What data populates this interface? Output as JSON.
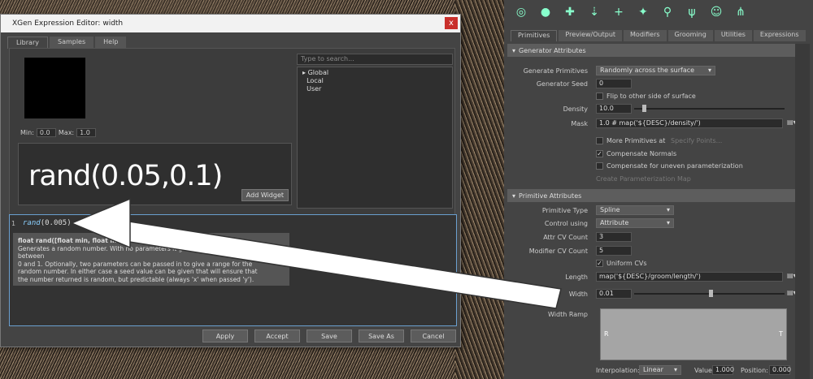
{
  "dialog": {
    "title": "XGen Expression Editor: width",
    "close": "x",
    "tabs": [
      "Library",
      "Samples",
      "Help"
    ],
    "min_label": "Min:",
    "min_value": "0.0",
    "max_label": "Max:",
    "max_value": "1.0",
    "big_expression": "rand(0.05,0.1)",
    "add_widget": "Add Widget",
    "search_placeholder": "Type to search...",
    "tree": [
      "Global",
      "Local",
      "User"
    ],
    "line_number": "1",
    "code_fn": "rand",
    "code_args": "(0.005)",
    "doc_signature": "float rand([float min, float ma",
    "doc_lines": [
      "Generates a random number. With no parameters it generates a random number between",
      "0 and 1. Optionally, two parameters can be passed in to give a range for the",
      "random number. In either case a seed value can be given that will ensure that",
      "the number returned is random, but predictable (always 'x' when passed 'y')."
    ],
    "buttons": [
      "Apply",
      "Accept",
      "Save",
      "Save As",
      "Cancel"
    ]
  },
  "attr": {
    "tabs": [
      "Primitives",
      "Preview/Output",
      "Modifiers",
      "Grooming",
      "Utilities",
      "Expressions"
    ],
    "gen_section": "Generator Attributes",
    "generate_primitives_label": "Generate Primitives",
    "generate_primitives": "Randomly across the surface",
    "generator_seed_label": "Generator Seed",
    "generator_seed": "0",
    "flip_label": "Flip to other side of surface",
    "density_label": "Density",
    "density": "10.0",
    "mask_label": "Mask",
    "mask": "1.0 # map('${DESC}/density/')",
    "more_primitives": "More Primitives at",
    "specify_points": "Specify Points...",
    "compensate_normals": "Compensate Normals",
    "compensate_uneven": "Compensate for uneven parameterization",
    "create_param_map": "Create Parameterization Map",
    "prim_section": "Primitive Attributes",
    "primitive_type_label": "Primitive Type",
    "primitive_type": "Spline",
    "control_using_label": "Control using",
    "control_using": "Attribute",
    "attr_cv_label": "Attr CV Count",
    "attr_cv": "3",
    "mod_cv_label": "Modifier CV Count",
    "mod_cv": "5",
    "uniform_cvs": "Uniform CVs",
    "length_label": "Length",
    "length": "map('${DESC}/groom/length/')",
    "width_label": "Width",
    "width": "0.01",
    "width_ramp_label": "Width Ramp",
    "ramp_r": "R",
    "ramp_t": "T",
    "interp_label": "Interpolation:",
    "interp": "Linear",
    "value_label": "Value:",
    "value": "1.000",
    "position_label": "Position:",
    "position": "0.000"
  },
  "colors": {
    "accent": "#6a9fcf",
    "close": "#c9302c"
  }
}
